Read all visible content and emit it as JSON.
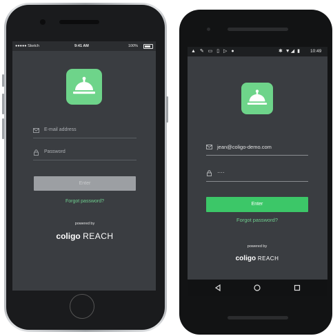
{
  "iphone": {
    "status": {
      "carrier": "●●●●● Sketch",
      "time": "9:41 AM",
      "battery": "100%"
    },
    "email_placeholder": "E-mail address",
    "password_placeholder": "Password",
    "enter_label": "Enter",
    "forgot_label": "Forgot password?",
    "powered_by": "powered by",
    "brand_bold": "coligo",
    "brand_light": "REACH"
  },
  "android": {
    "status": {
      "time": "10:49"
    },
    "email_value": "jean@coligo-demo.com",
    "password_value": "····",
    "enter_label": "Enter",
    "forgot_label": "Forgot password?",
    "powered_by": "powered by",
    "brand_bold": "coligo",
    "brand_light": "REACH"
  },
  "colors": {
    "accent": "#3cc768",
    "logo_tile": "#6ed48a",
    "screen_bg": "#3a3d41"
  }
}
